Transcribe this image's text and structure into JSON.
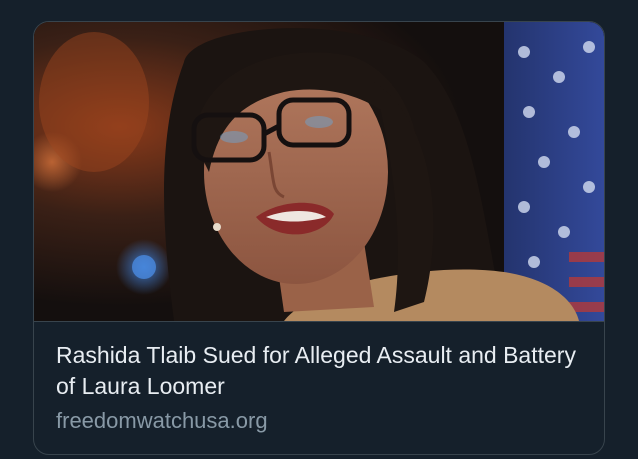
{
  "card": {
    "headline": "Rashida Tlaib Sued for Alleged Assault and Battery of Laura Loomer",
    "domain": "freedomwatchusa.org",
    "image_description_icon": "news-photo"
  },
  "colors": {
    "background": "#15202b",
    "border": "#38444d",
    "headline": "#e8edf2",
    "domain": "#8899a6"
  }
}
